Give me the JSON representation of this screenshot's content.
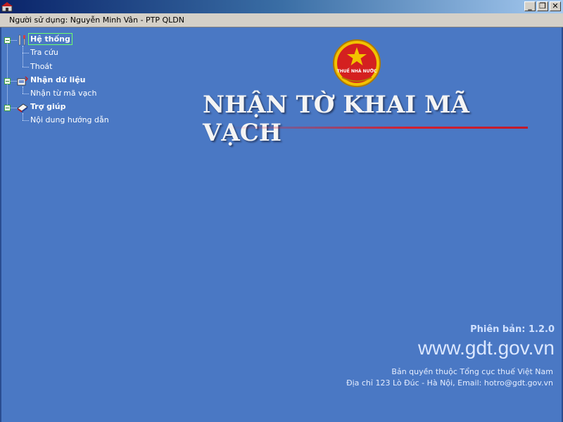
{
  "user_bar": {
    "text": "Người sử dụng: Nguyễn Minh Vân - PTP QLDN"
  },
  "window_buttons": {
    "minimize": "_",
    "restore": "❐",
    "close": "✕"
  },
  "tree": {
    "groups": [
      {
        "label": "Hệ thống",
        "icon": "tools-icon",
        "children": [
          "Tra cứu",
          "Thoát"
        ]
      },
      {
        "label": "Nhận dữ liệu",
        "icon": "data-receive-icon",
        "children": [
          "Nhận từ mã vạch"
        ]
      },
      {
        "label": "Trợ giúp",
        "icon": "help-book-icon",
        "children": [
          "Nội dung hướng dẫn"
        ]
      }
    ]
  },
  "title": {
    "main": "NHẬN TỜ KHAI MÃ VẠCH",
    "emblem_text": "THUẾ NHÀ NƯỚC"
  },
  "footer": {
    "version": "Phiên bản: 1.2.0",
    "website": "www.gdt.gov.vn",
    "copyright": "Bản quyền thuộc Tổng cục thuế Việt Nam",
    "address": "Địa chỉ 123 Lò Đúc - Hà Nội,  Email: hotro@gdt.gov.vn"
  },
  "colors": {
    "background": "#4a78c4",
    "accent_red": "#d22030",
    "emblem_gold": "#f2c200"
  }
}
